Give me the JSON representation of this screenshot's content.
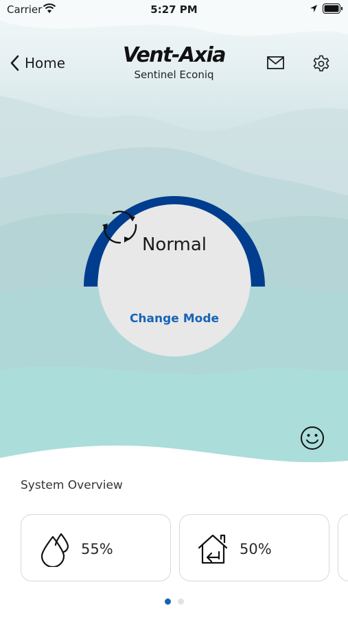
{
  "status_bar": {
    "carrier": "Carrier",
    "time": "5:27 PM"
  },
  "nav": {
    "back_label": "Home",
    "brand": "Vent-Axia",
    "product": "Sentinel Econiq"
  },
  "mode": {
    "name": "Normal",
    "change_label": "Change Mode"
  },
  "overview": {
    "title": "System Overview",
    "cards": [
      {
        "icon": "humidity-icon",
        "value": "55%"
      },
      {
        "icon": "house-return-icon",
        "value": "50%"
      }
    ],
    "page_count": 2,
    "active_page": 0
  },
  "colors": {
    "accent": "#003d8f",
    "link": "#1565b8",
    "dot_active": "#1464b4"
  }
}
